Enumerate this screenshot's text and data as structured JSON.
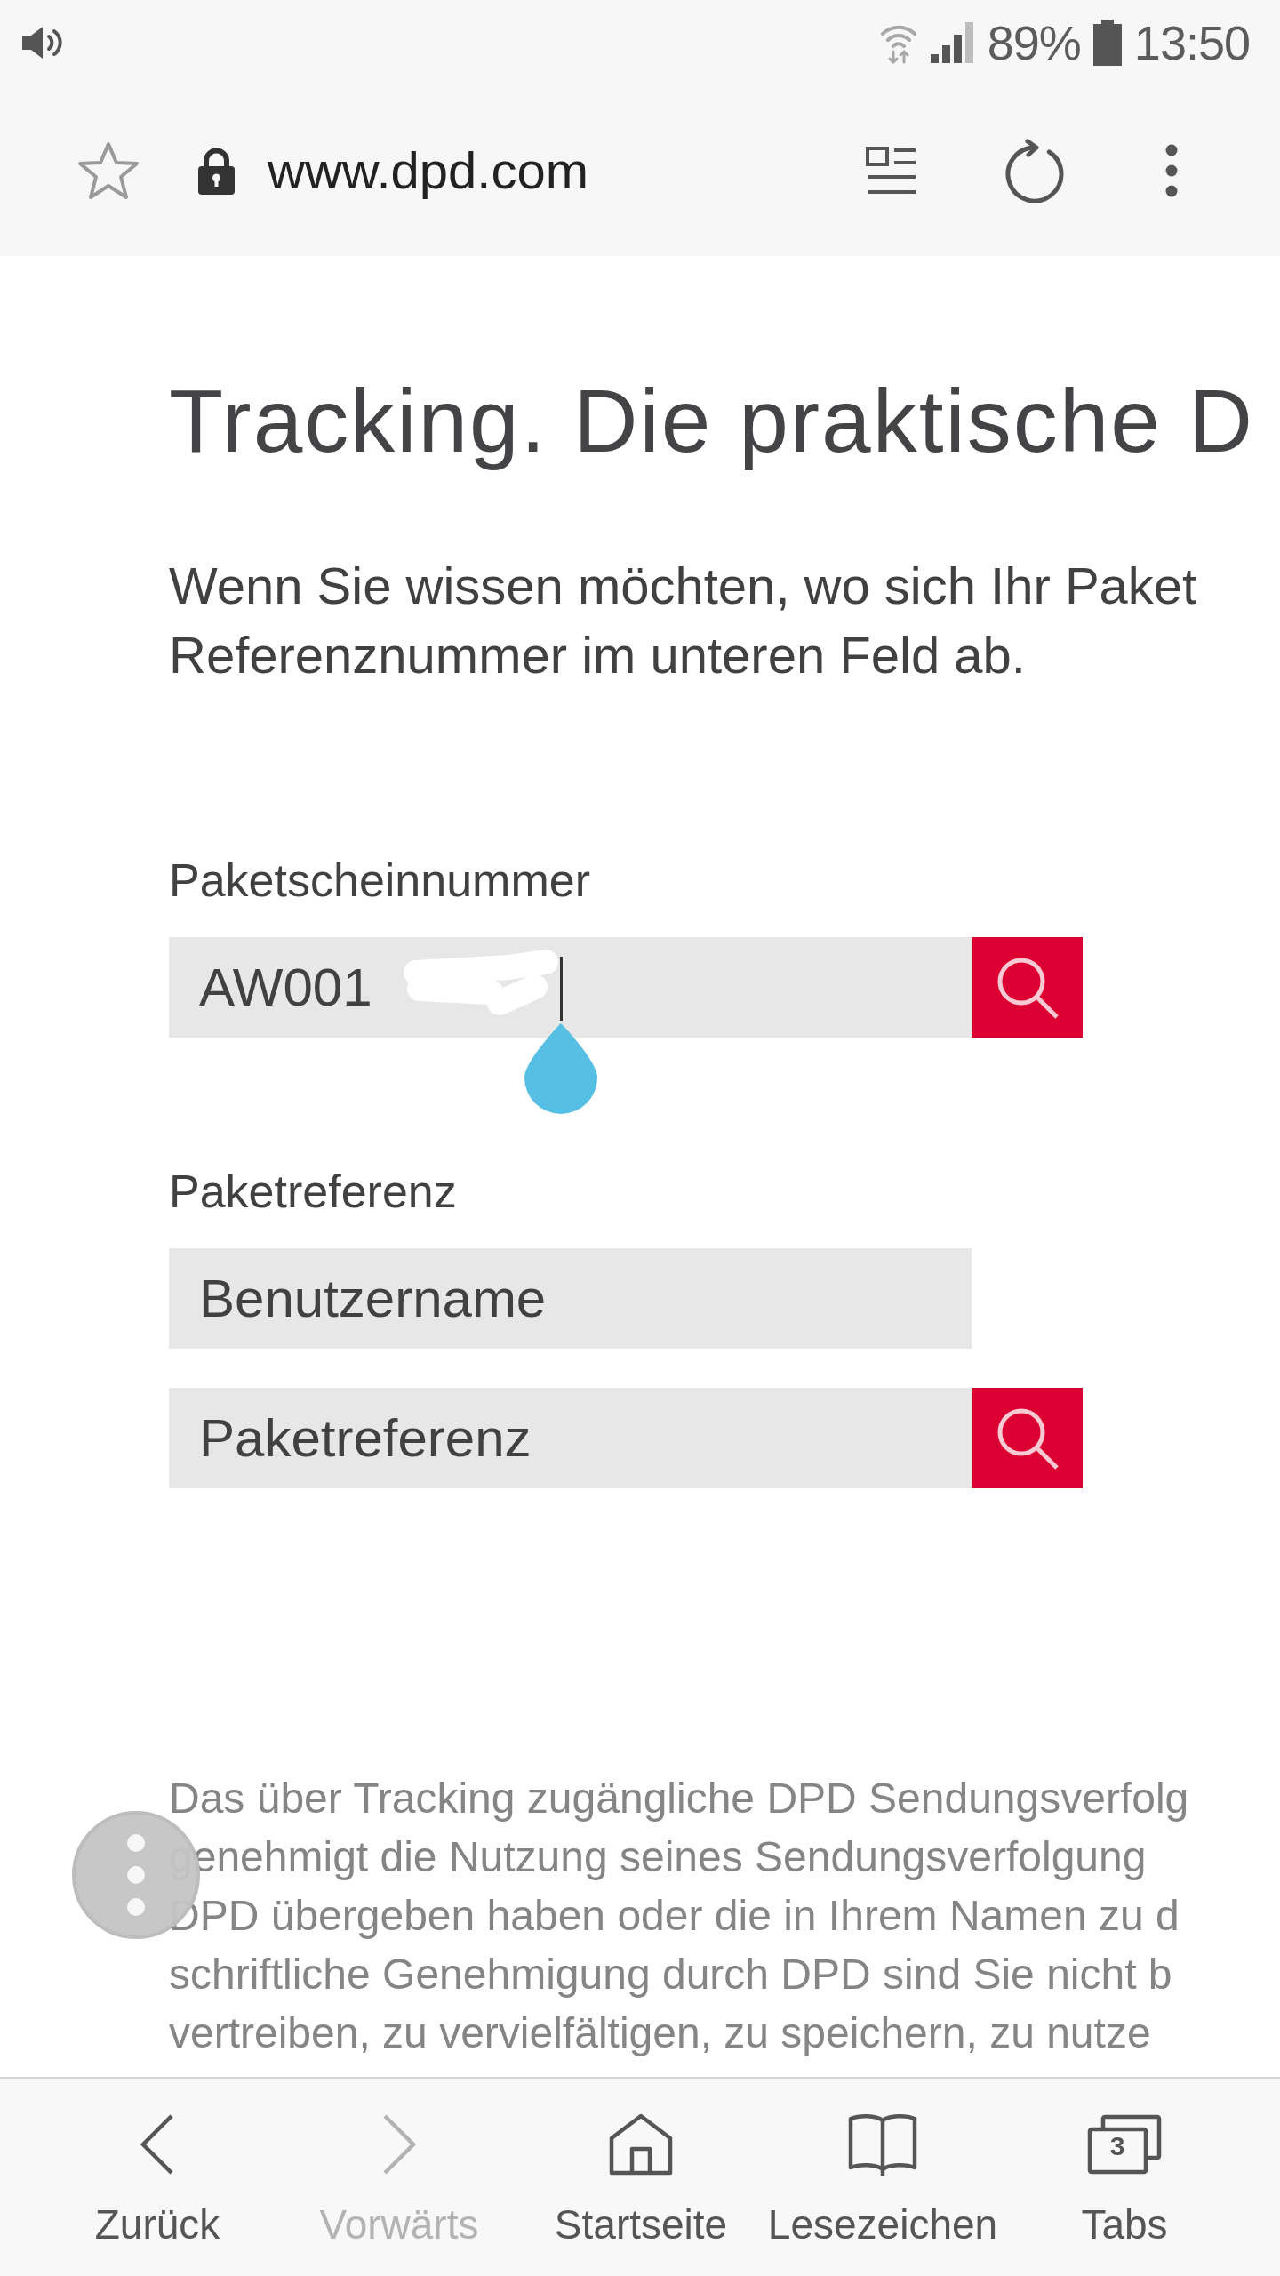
{
  "status_bar": {
    "battery": "89%",
    "time": "13:50"
  },
  "browser_toolbar": {
    "url": "www.dpd.com"
  },
  "page": {
    "heading": "Tracking. Die praktische D",
    "intro_lines": [
      "Wenn Sie wissen möchten, wo sich Ihr Paket",
      "Referenznummer im unteren Feld ab."
    ],
    "form_sections": [
      {
        "label": "Paketscheinnummer",
        "fields": [
          {
            "value": "AW001",
            "search_button": true,
            "focused": true,
            "redacted": true
          }
        ]
      },
      {
        "label": "Paketreferenz",
        "fields": [
          {
            "placeholder": "Benutzername",
            "search_button": false,
            "focused": false,
            "redacted": false
          },
          {
            "placeholder": "Paketreferenz",
            "search_button": true,
            "focused": false,
            "redacted": false
          }
        ]
      }
    ],
    "disclaimer_lines": [
      "Das über Tracking zugängliche DPD Sendungsverfolg",
      "genehmigt die Nutzung seines Sendungsverfolgung",
      "DPD übergeben haben oder die in Ihrem Namen zu d",
      "schriftliche Genehmigung durch DPD sind Sie nicht b",
      "vertreiben, zu vervielfältigen, zu speichern, zu nutze"
    ]
  },
  "bottom_nav": [
    {
      "kind": "back",
      "label": "Zurück",
      "disabled": false
    },
    {
      "kind": "forward",
      "label": "Vorwärts",
      "disabled": true
    },
    {
      "kind": "home",
      "label": "Startseite",
      "disabled": false
    },
    {
      "kind": "bookmarks",
      "label": "Lesezeichen",
      "disabled": false
    },
    {
      "kind": "tabs",
      "label": "Tabs",
      "disabled": false,
      "count": "3"
    }
  ]
}
